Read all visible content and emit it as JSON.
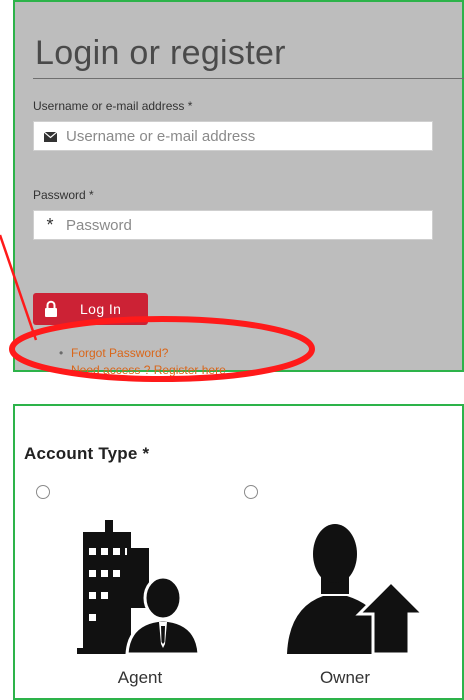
{
  "login": {
    "title": "Login or register",
    "username": {
      "label": "Username or e-mail address *",
      "placeholder": "Username or e-mail address",
      "value": ""
    },
    "password": {
      "label": "Password *",
      "placeholder": "Password",
      "value": ""
    },
    "login_button": "Log In",
    "links": [
      {
        "bullet": "•",
        "label": "Forgot Password?"
      },
      {
        "bullet": "•",
        "label": "Need access ? Register here"
      }
    ]
  },
  "account": {
    "title": "Account Type *",
    "options": [
      {
        "label": "Agent",
        "icon": "agent-building-icon",
        "selected": false
      },
      {
        "label": "Owner",
        "icon": "owner-house-icon",
        "selected": false
      }
    ]
  },
  "colors": {
    "panel_bg": "#bdbdbd",
    "panel_border": "#2db34a",
    "button": "#cc2235",
    "link": "#d9661a",
    "annotation": "#ff1a1a"
  }
}
